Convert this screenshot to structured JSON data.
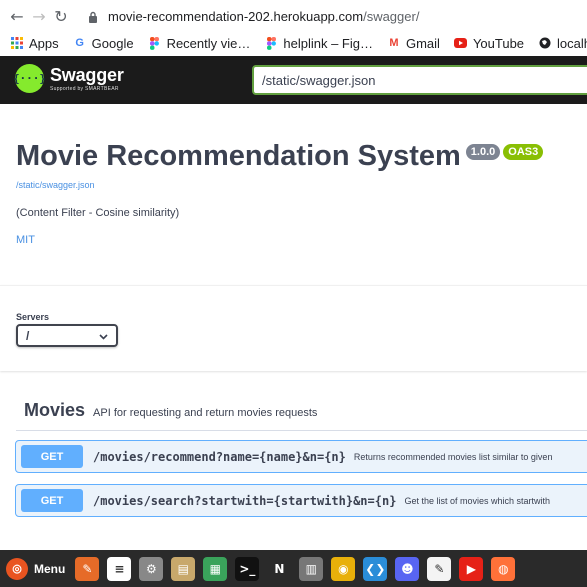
{
  "browser": {
    "url_host": "movie-recommendation-202.herokuapp.com",
    "url_path": "/swagger/",
    "bookmarks": [
      {
        "label": "Apps",
        "icon": "apps-grid-icon"
      },
      {
        "label": "Google",
        "icon": "google-icon"
      },
      {
        "label": "Recently vie…",
        "icon": "figma-icon"
      },
      {
        "label": "helplink – Fig…",
        "icon": "figma-icon"
      },
      {
        "label": "Gmail",
        "icon": "gmail-icon"
      },
      {
        "label": "YouTube",
        "icon": "youtube-icon"
      },
      {
        "label": "localh",
        "icon": "globe-icon"
      }
    ]
  },
  "swagger": {
    "logo_title": "Swagger",
    "logo_subtitle": "Supported by SMARTBEAR",
    "spec_url": "/static/swagger.json"
  },
  "info": {
    "title": "Movie Recommendation System",
    "version": "1.0.0",
    "oas": "OAS3",
    "spec_link": "/static/swagger.json",
    "description": "(Content Filter - Cosine similarity)",
    "license": "MIT"
  },
  "servers": {
    "label": "Servers",
    "selected": "/"
  },
  "tag": {
    "name": "Movies",
    "description": "API for requesting and return movies requests"
  },
  "operations": [
    {
      "method": "GET",
      "path": "/movies/recommend?name={name}&n={n}",
      "summary": "Returns recommended movies list similar to given"
    },
    {
      "method": "GET",
      "path": "/movies/search?startwith={startwith}&n={n}",
      "summary": "Get the list of movies which startwith"
    }
  ],
  "taskbar": {
    "menu_label": "Menu",
    "apps": [
      {
        "name": "firefox-like-icon",
        "color": "#e66b28",
        "glyph": "✎"
      },
      {
        "name": "text-editor-icon",
        "color": "#ffffff",
        "glyph": "≡"
      },
      {
        "name": "settings-icon",
        "color": "#888888",
        "glyph": "⚙"
      },
      {
        "name": "archive-icon",
        "color": "#c8a86b",
        "glyph": "▤"
      },
      {
        "name": "spreadsheet-icon",
        "color": "#3aa35b",
        "glyph": "▦"
      },
      {
        "name": "terminal-icon",
        "color": "#111111",
        "glyph": ">_"
      },
      {
        "name": "notion-icon",
        "color": "#2a2a2a",
        "glyph": "N"
      },
      {
        "name": "calculator-icon",
        "color": "#777777",
        "glyph": "▥"
      },
      {
        "name": "chrome-icon",
        "color": "#e8b00a",
        "glyph": "◉"
      },
      {
        "name": "vscode-icon",
        "color": "#2a8dd8",
        "glyph": "❮❯"
      },
      {
        "name": "discord-icon",
        "color": "#5865f2",
        "glyph": "☻"
      },
      {
        "name": "notes-icon",
        "color": "#f4f4f4",
        "glyph": "✎"
      },
      {
        "name": "youtube-app-icon",
        "color": "#e62117",
        "glyph": "▶"
      },
      {
        "name": "firefox-icon",
        "color": "#ff7139",
        "glyph": "◍"
      }
    ]
  }
}
